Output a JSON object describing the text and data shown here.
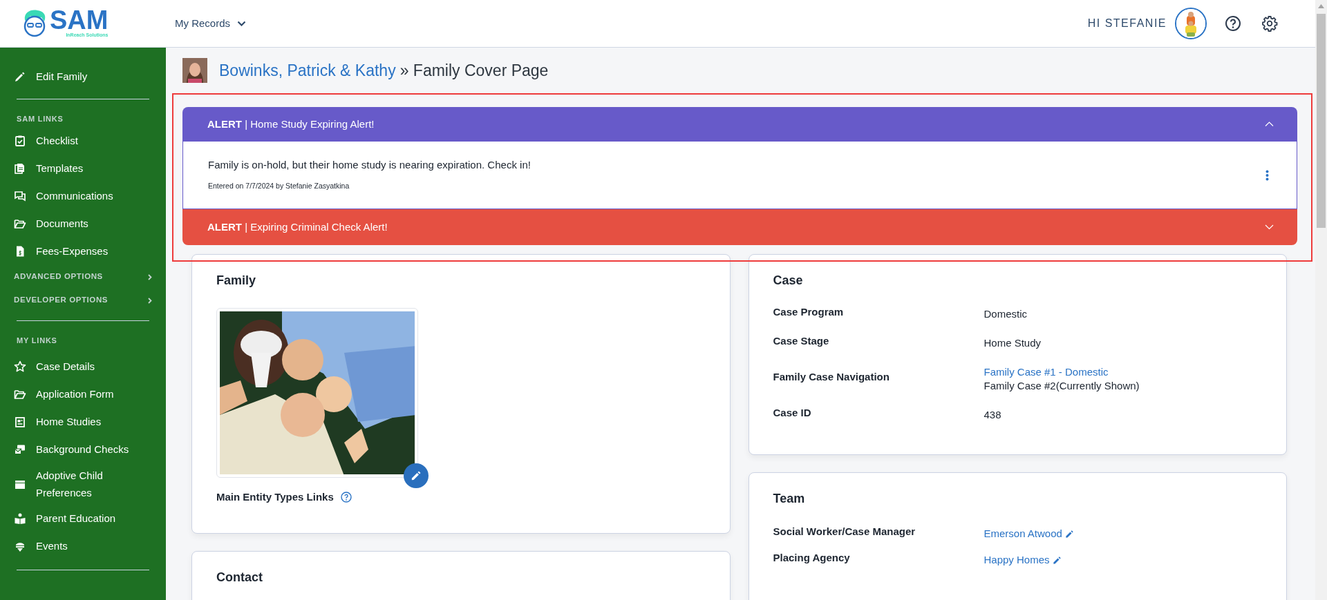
{
  "header": {
    "logo_title": "SAM",
    "logo_subtitle": "InReach Solutions",
    "menu": "My Records",
    "greeting": "HI STEFANIE"
  },
  "sidebar": {
    "groups": [
      {
        "items": [
          {
            "kind": "link",
            "label": "Edit Family"
          }
        ]
      },
      {
        "heading": "SAM LINKS",
        "items": [
          {
            "kind": "link",
            "label": "Checklist"
          },
          {
            "kind": "link",
            "label": "Templates"
          },
          {
            "kind": "link",
            "label": "Communications"
          },
          {
            "kind": "link",
            "label": "Documents"
          },
          {
            "kind": "link",
            "label": "Fees-Expenses"
          },
          {
            "kind": "expander",
            "label": "ADVANCED OPTIONS"
          },
          {
            "kind": "expander",
            "label": "DEVELOPER OPTIONS"
          }
        ]
      },
      {
        "heading": "MY LINKS",
        "items": [
          {
            "kind": "link",
            "label": "Case Details"
          },
          {
            "kind": "link",
            "label": "Application Form"
          },
          {
            "kind": "link",
            "label": "Home Studies"
          },
          {
            "kind": "link",
            "label": "Background Checks"
          },
          {
            "kind": "link",
            "label": "Adoptive Child Preferences"
          },
          {
            "kind": "link",
            "label": "Parent Education"
          },
          {
            "kind": "link",
            "label": "Events"
          }
        ]
      }
    ]
  },
  "breadcrumb": {
    "link": "Bowinks, Patrick & Kathy",
    "heading": "» Family Cover Page"
  },
  "alerts": [
    {
      "title": "**ALERT**  | Home Study Expiring Alert!",
      "color": "#675ac9",
      "expanded": true,
      "message": "Family is on-hold, but their home study is nearing expiration. Check in!",
      "entered": "Entered on 7/7/2024 by Stefanie Zasyatkina"
    },
    {
      "title": "**ALERT**  | Expiring Criminal Check Alert!",
      "color": "#e55042",
      "expanded": false
    }
  ],
  "family_card": {
    "title": "Family",
    "links_label": "Main Entity Types Links"
  },
  "contact_card": {
    "title": "Contact"
  },
  "case_card": {
    "title": "Case",
    "fields": [
      {
        "label": "Case Program",
        "values": [
          {
            "text": "Domestic",
            "link": false,
            "editable": false
          }
        ]
      },
      {
        "label": "Case Stage",
        "values": [
          {
            "text": "Home Study",
            "link": false,
            "editable": false
          }
        ]
      },
      {
        "label": "Family Case Navigation",
        "values": [
          {
            "text": "Family Case #1 - Domestic",
            "link": true,
            "editable": false
          },
          {
            "text": "Family Case #2(Currently Shown)",
            "link": false,
            "editable": false
          }
        ]
      },
      {
        "label": "Case ID",
        "values": [
          {
            "text": "438",
            "link": false,
            "editable": false
          }
        ]
      }
    ]
  },
  "team_card": {
    "title": "Team",
    "fields": [
      {
        "label": "Social Worker/Case Manager",
        "values": [
          {
            "text": "Emerson Atwood",
            "link": true,
            "editable": true
          }
        ]
      },
      {
        "label": "Placing Agency",
        "values": [
          {
            "text": "Happy Homes",
            "link": true,
            "editable": true
          }
        ]
      }
    ]
  }
}
